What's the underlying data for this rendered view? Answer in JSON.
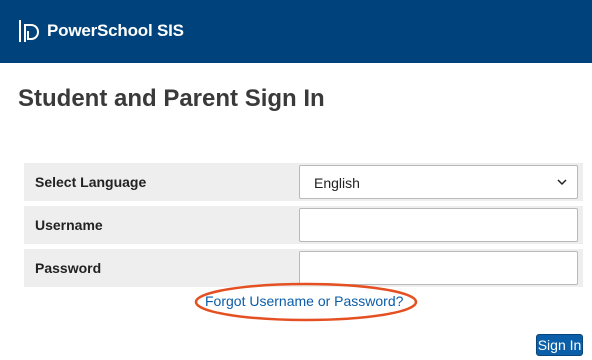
{
  "header": {
    "brand": "PowerSchool SIS",
    "logo_icon": "powerschool-logo-icon",
    "background_color": "#00427c"
  },
  "page": {
    "title": "Student and Parent Sign In"
  },
  "form": {
    "language": {
      "label": "Select Language",
      "value": "English",
      "icon": "chevron-down-icon"
    },
    "username": {
      "label": "Username",
      "value": ""
    },
    "password": {
      "label": "Password",
      "value": ""
    },
    "forgot_link": "Forgot Username or Password?",
    "sign_in_label": "Sign In"
  },
  "colors": {
    "link": "#0b5da8",
    "button": "#0a5fa8",
    "row_background": "#eeeeee",
    "annotation": "#e45022"
  }
}
